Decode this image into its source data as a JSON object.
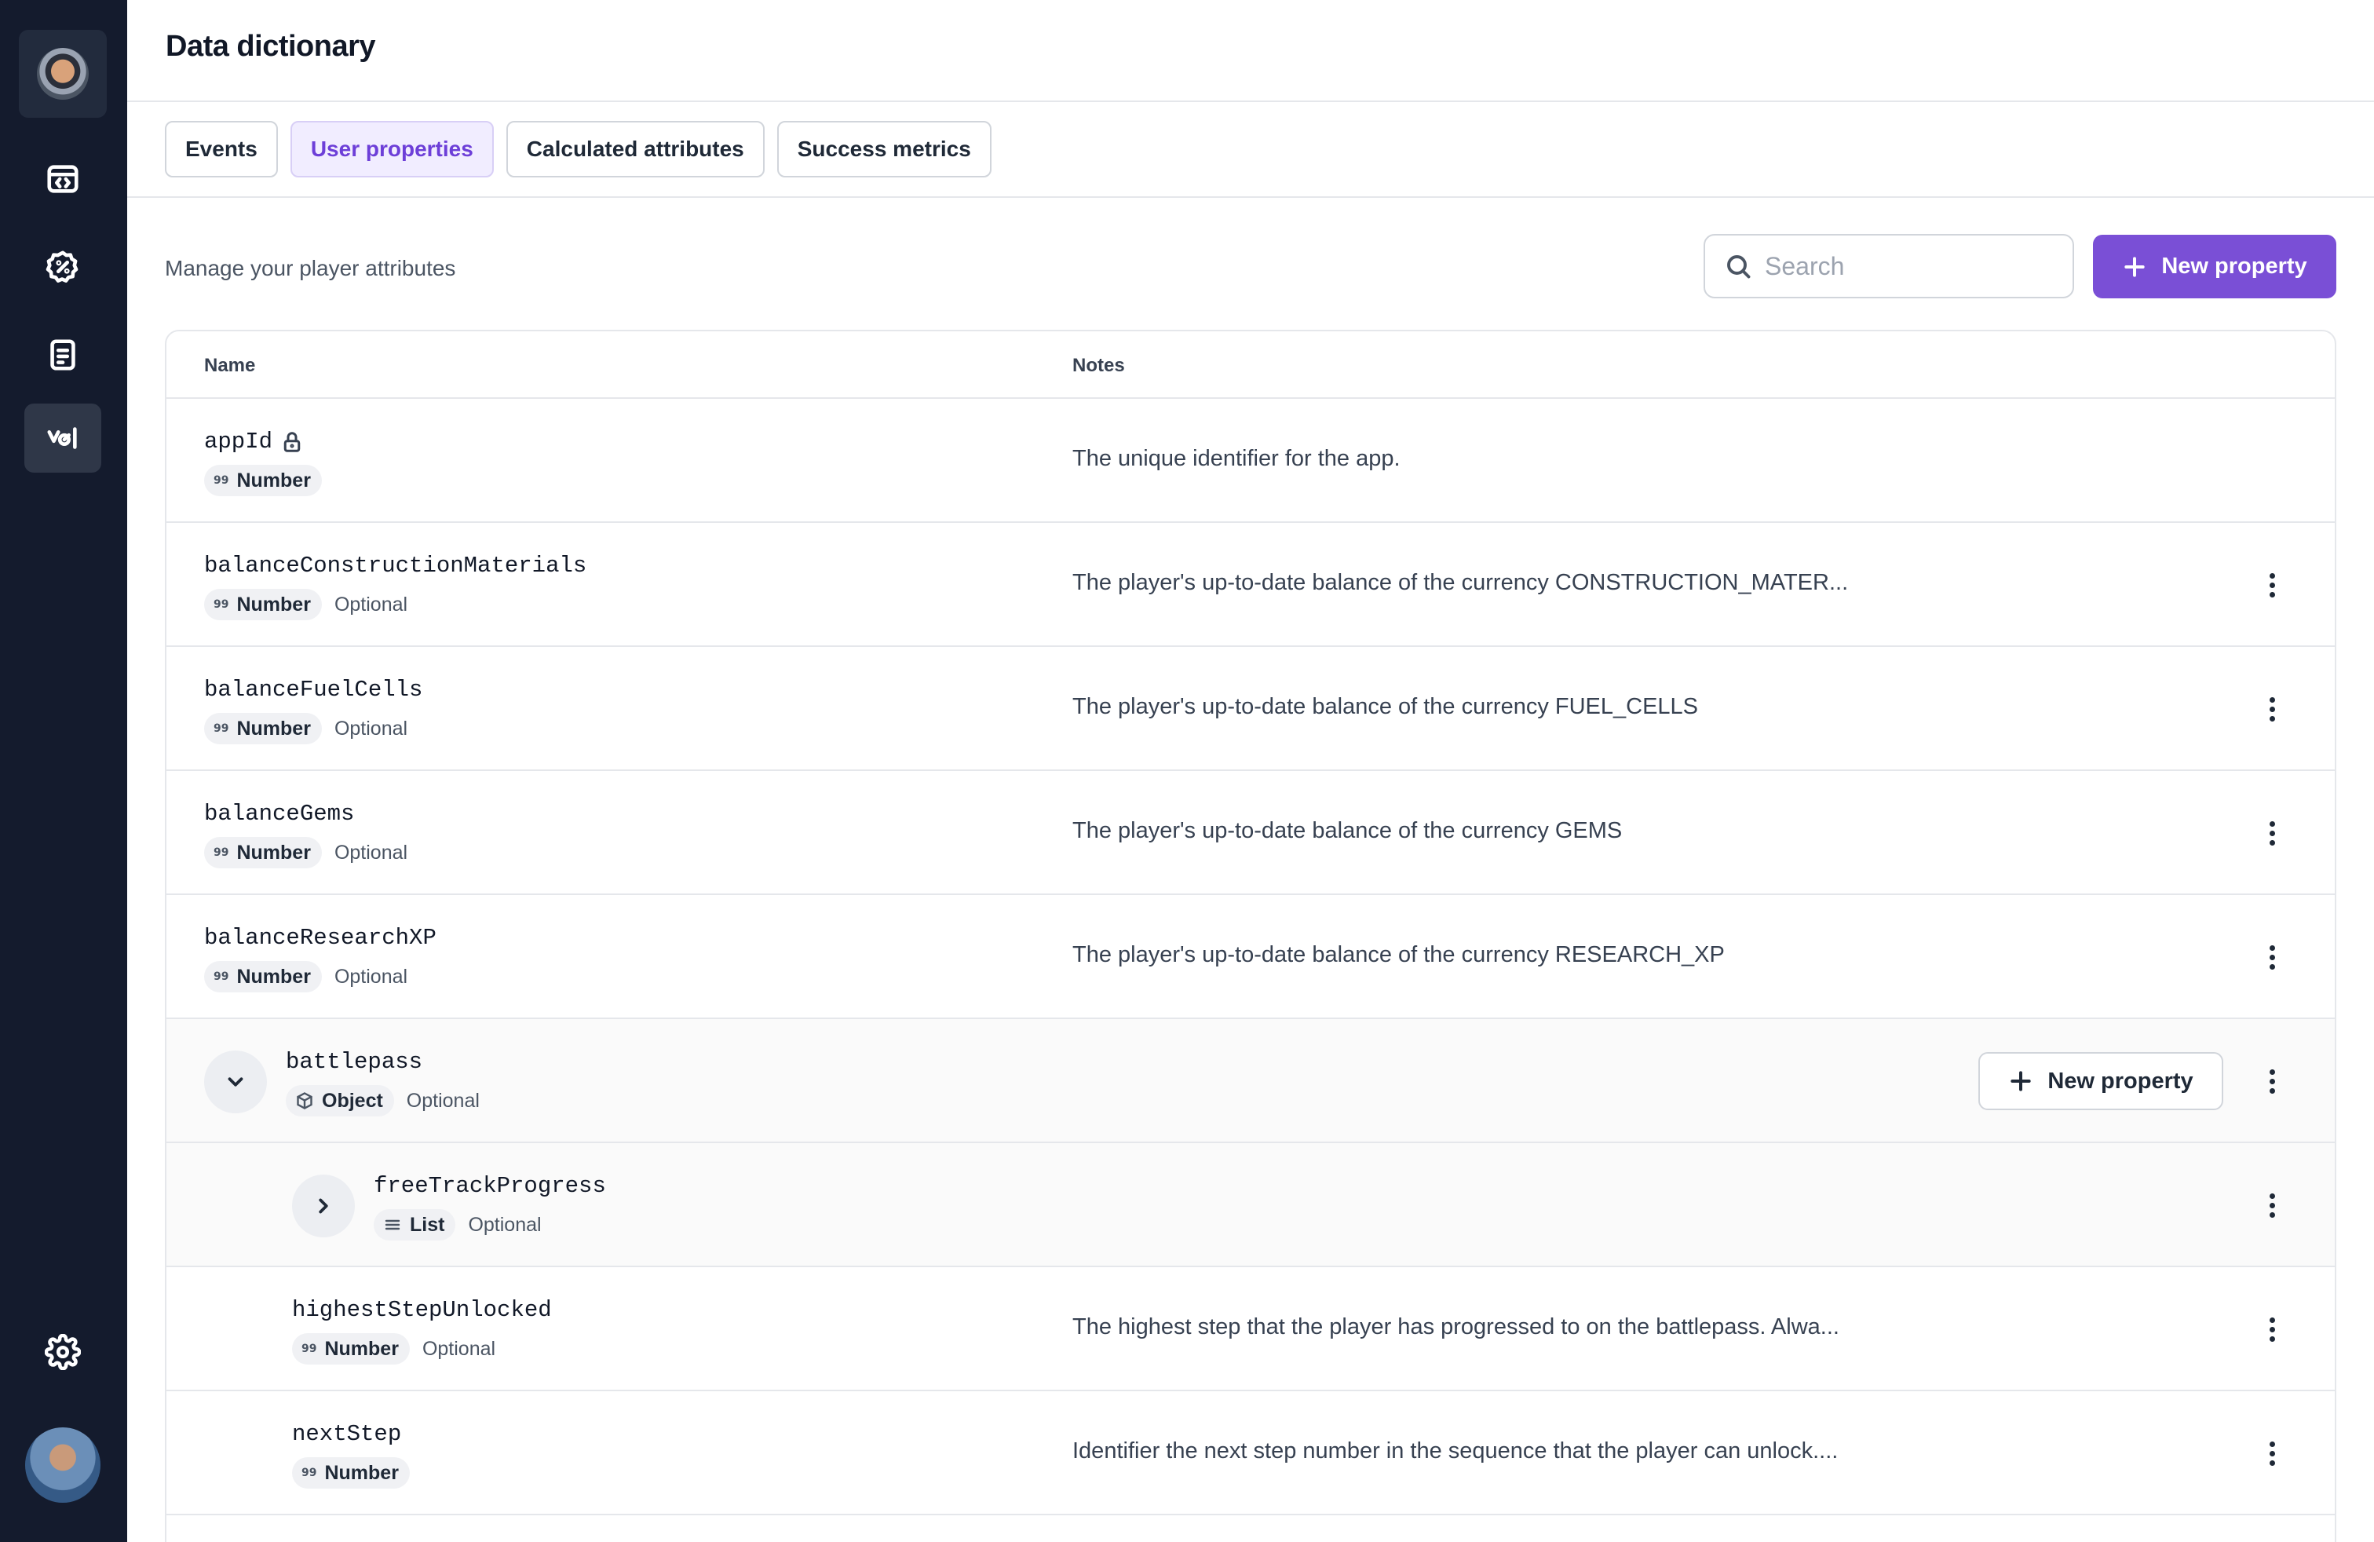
{
  "page": {
    "title": "Data dictionary",
    "subtitle": "Manage your player attributes"
  },
  "sidebar": {
    "items": [
      {
        "name": "code-window-icon"
      },
      {
        "name": "badge-percent-icon"
      },
      {
        "name": "document-icon"
      },
      {
        "name": "analytics-icon",
        "active": true
      }
    ],
    "settings_icon": "gear-icon"
  },
  "tabs": [
    {
      "label": "Events",
      "active": false
    },
    {
      "label": "User properties",
      "active": true
    },
    {
      "label": "Calculated attributes",
      "active": false
    },
    {
      "label": "Success metrics",
      "active": false
    }
  ],
  "search": {
    "placeholder": "Search",
    "value": ""
  },
  "new_property_label": "New property",
  "table": {
    "columns": [
      "Name",
      "Notes"
    ],
    "rows": [
      {
        "name": "appId",
        "type": "Number",
        "optional": "",
        "notes": "The unique identifier for the app.",
        "locked": true
      },
      {
        "name": "balanceConstructionMaterials",
        "type": "Number",
        "optional": "Optional",
        "notes": "The player's up-to-date balance of the currency CONSTRUCTION_MATER..."
      },
      {
        "name": "balanceFuelCells",
        "type": "Number",
        "optional": "Optional",
        "notes": "The player's up-to-date balance of the currency FUEL_CELLS"
      },
      {
        "name": "balanceGems",
        "type": "Number",
        "optional": "Optional",
        "notes": "The player's up-to-date balance of the currency GEMS"
      },
      {
        "name": "balanceResearchXP",
        "type": "Number",
        "optional": "Optional",
        "notes": "The player's up-to-date balance of the currency RESEARCH_XP"
      },
      {
        "name": "battlepass",
        "type": "Object",
        "optional": "Optional",
        "notes": "",
        "expanded": true,
        "add_label": "New property"
      },
      {
        "name": "freeTrackProgress",
        "type": "List",
        "optional": "Optional",
        "notes": "",
        "expanded": false
      },
      {
        "name": "highestStepUnlocked",
        "type": "Number",
        "optional": "Optional",
        "notes": "The highest step that the player has progressed to on the battlepass. Alwa..."
      },
      {
        "name": "nextStep",
        "type": "Number",
        "optional": "",
        "notes": "Identifier the next step number in the sequence that the player can unlock...."
      }
    ]
  },
  "colors": {
    "accent": "#7a4fd6",
    "sidebar": "#141b2d",
    "active_tab_bg": "#f1edff"
  }
}
